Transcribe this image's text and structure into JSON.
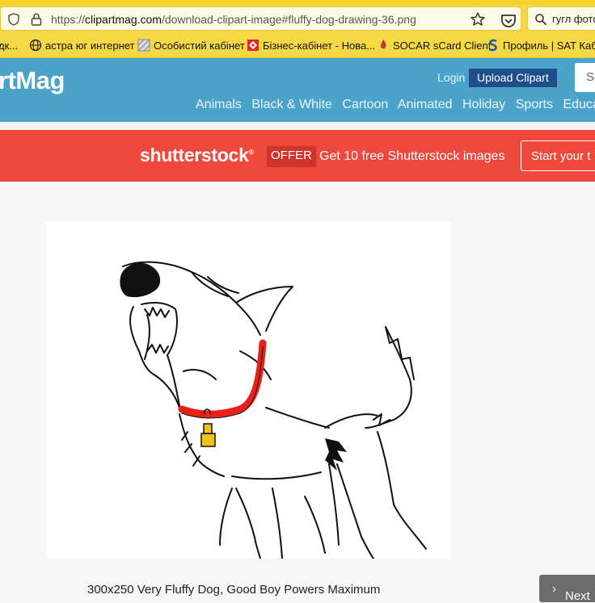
{
  "browser": {
    "url_prefix": "https://",
    "url_host": "clipartmag.com",
    "url_path": "/download-clipart-image#fluffy-dog-drawing-36.png",
    "search_text": "гугл фото"
  },
  "bookmarks": [
    {
      "label": "дк...",
      "icon": "bookmark-icon"
    },
    {
      "label": "астра юг интернет",
      "icon": "globe-icon"
    },
    {
      "label": "Особистий кабінет",
      "icon": "grid-icon"
    },
    {
      "label": "Бізнес-кабінет - Нова...",
      "icon": "nova-poshta-icon"
    },
    {
      "label": "SOCAR sCard Client",
      "icon": "socar-flame-icon"
    },
    {
      "label": "Профиль | SAT Кабин",
      "icon": "s-logo-icon"
    }
  ],
  "site": {
    "logo": "rtMag",
    "login": "Login",
    "upload": "Upload Clipart",
    "search_placeholder": "Se",
    "nav": [
      "Animals",
      "Black & White",
      "Cartoon",
      "Animated",
      "Holiday",
      "Sports",
      "Education"
    ]
  },
  "banner": {
    "brand": "shutterstock",
    "offer": "OFFER",
    "message": "Get 10 free Shutterstock images",
    "cta": "Start your t"
  },
  "content": {
    "caption": "300x250 Very Fluffy Dog, Good Boy Powers Maximum",
    "next": "Next"
  },
  "colors": {
    "chrome_yellow": "#f3d64a",
    "header_blue": "#4ca3c9",
    "upload_blue": "#1e4f8c",
    "banner_red": "#f0483c",
    "collar_red": "#e8201a"
  }
}
